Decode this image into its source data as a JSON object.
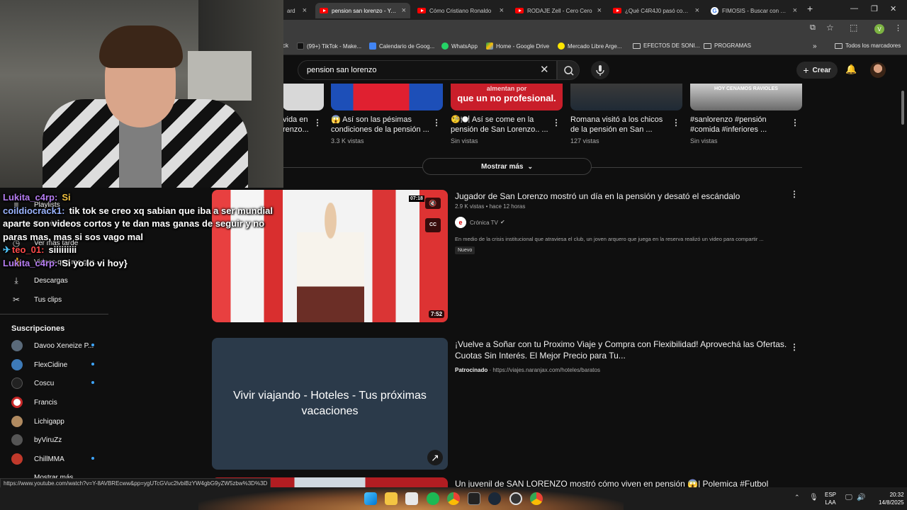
{
  "browser": {
    "tabs": [
      {
        "label": "ard"
      },
      {
        "label": "pension san lorenzo - YouTube",
        "active": true
      },
      {
        "label": "Cómo Cristiano Ronaldo"
      },
      {
        "label": "RODAJE Zell - Cero Cero"
      },
      {
        "label": "¿Qué C4R4J0 pasó con C..."
      },
      {
        "label": "FIMOSIS - Buscar con Google"
      }
    ],
    "bookmarks": [
      {
        "label": "ck"
      },
      {
        "label": "(99+) TikTok - Make..."
      },
      {
        "label": "Calendario de Goog..."
      },
      {
        "label": "WhatsApp"
      },
      {
        "label": "Home - Google Drive"
      },
      {
        "label": "Mercado Libre Arge..."
      },
      {
        "label": "EFECTOS DE SONI..."
      },
      {
        "label": "PROGRAMAS"
      },
      {
        "label": "Todos los marcadores"
      }
    ],
    "profile_initial": "V",
    "status_url": "https://www.youtube.com/watch?v=Y-8AVBREcww&pp=ygUTcGVuc2lvbiBzYW4gbG9yZW5zbw%3D%3D"
  },
  "youtube": {
    "search_value": "pension san lorenzo",
    "create_label": "Crear",
    "shorts": [
      {
        "title": "vida en\nrenzo...",
        "views": ""
      },
      {
        "title": "😱 Así son las pésimas condiciones de la pensión ...",
        "views": "3.3 K vistas"
      },
      {
        "title": "🧐🍽️ Así se come en la pensión de San Lorenzo.. ...",
        "views": "Sin vistas"
      },
      {
        "title": "Romana visitó a los chicos de la pensión en San ...",
        "views": "127 vistas"
      },
      {
        "title": "#sanlorenzo #pensión #comida #inferiores ...",
        "views": "Sin vistas"
      }
    ],
    "shorts_thumb_texts": [
      "almentan por",
      "que un no profesional.",
      "HOY CENAMOS RAVIOLES"
    ],
    "show_more_label": "Mostrar más",
    "videos": [
      {
        "title": "Jugador de San Lorenzo mostró un día en la pensión y desató el escándalo",
        "views": "2.9 K vistas",
        "age": "hace 12 horas",
        "channel": "Crónica TV",
        "description": "En medio de la crisis institucional que atraviesa el club, un joven arquero que juega en la reserva realizó un video para compartir ...",
        "badge": "Nuevo",
        "duration": "7:52",
        "overlay_time": "07:18",
        "cc_label": "CC"
      },
      {
        "title": "Un juvenil de SAN LORENZO mostró cómo viven en pensión 😱| Polemica #Futbol"
      }
    ],
    "ad": {
      "title": "¡Vuelve a Soñar con tu Proximo Viaje y Compra con Flexibilidad! Aprovechá las Ofertas. Cuotas Sin Interés. El Mejor Precio para Tu...",
      "sponsor_label": "Patrocinado",
      "url": "https://viajes.naranjax.com/hoteles/baratos",
      "thumb_text": "Vivir viajando - Hoteles - Tus próximas vacaciones"
    },
    "sidebar": {
      "items": [
        {
          "label": "Playlists",
          "icon": "playlist-icon"
        },
        {
          "label": "Tus videos",
          "icon": "video-icon"
        },
        {
          "label": "Ver más tarde",
          "icon": "clock-icon"
        },
        {
          "label": "Videos que me gus...",
          "icon": "like-icon"
        },
        {
          "label": "Descargas",
          "icon": "download-icon"
        },
        {
          "label": "Tus clips",
          "icon": "scissors-icon"
        }
      ],
      "subscriptions_title": "Suscripciones",
      "subscriptions": [
        {
          "name": "Davoo Xeneize P...",
          "color": "#5a6a7a"
        },
        {
          "name": "FlexCidine",
          "color": "#3d7ab8"
        },
        {
          "name": "Coscu",
          "color": "#222222"
        },
        {
          "name": "Francis",
          "color": "#ffffff"
        },
        {
          "name": "Lichigapp",
          "color": "#b08a60"
        },
        {
          "name": "byViruZz",
          "color": "#555555"
        },
        {
          "name": "ChillMMA",
          "color": "#c0392b"
        }
      ],
      "more_label": "Mostrar más"
    }
  },
  "stream_chat": [
    {
      "user": "Lukita_c4rp:",
      "user_color": "#b57cf0",
      "text": "Si",
      "text_color": "#f0c040"
    },
    {
      "user": "coildiocrack1:",
      "user_color": "#9bb4ff",
      "text": "tik tok se creo xq sabian que iba a ser mundial aparte son videos cortos y te dan mas ganas de seguir y no paras mas, mas si sos vago mal",
      "text_color": "#ffffff"
    },
    {
      "user": "teo_01:",
      "user_color": "#ff4a4a",
      "text": "siiiiiiiii",
      "text_color": "#ffffff"
    },
    {
      "user": "Lukita_c4rp:",
      "user_color": "#b57cf0",
      "text": "Si yo lo vi hoy}",
      "text_color": "#ffffff"
    }
  ],
  "taskbar": {
    "lang": "ESP",
    "region": "LAA",
    "time": "20:32",
    "date": "14/8/2025"
  }
}
